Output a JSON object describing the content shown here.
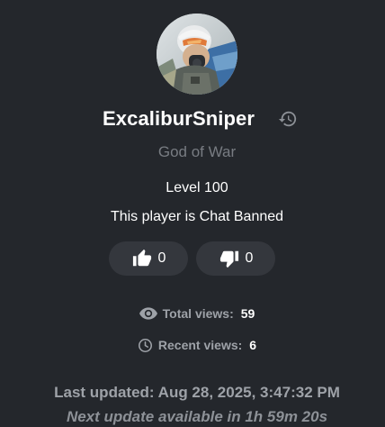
{
  "profile": {
    "player_name": "ExcaliburSniper",
    "title": "God of War",
    "level": "Level 100",
    "status": "This player is Chat Banned",
    "avatar_icon": "pilot-avatar"
  },
  "votes": {
    "likes": "0",
    "dislikes": "0",
    "like_icon": "thumbs-up-icon",
    "dislike_icon": "thumbs-down-icon"
  },
  "stats": {
    "total_views_label": "Total views:",
    "total_views_value": "59",
    "recent_views_label": "Recent views:",
    "recent_views_value": "6"
  },
  "update": {
    "last_updated": "Last updated: Aug 28, 2025, 3:47:32 PM",
    "next_update": "Next update available in 1h 59m 20s"
  },
  "colors": {
    "background": "#24272c",
    "button_bg": "#34373d",
    "muted_text": "#9ea2a8",
    "title_text": "#787c82"
  }
}
